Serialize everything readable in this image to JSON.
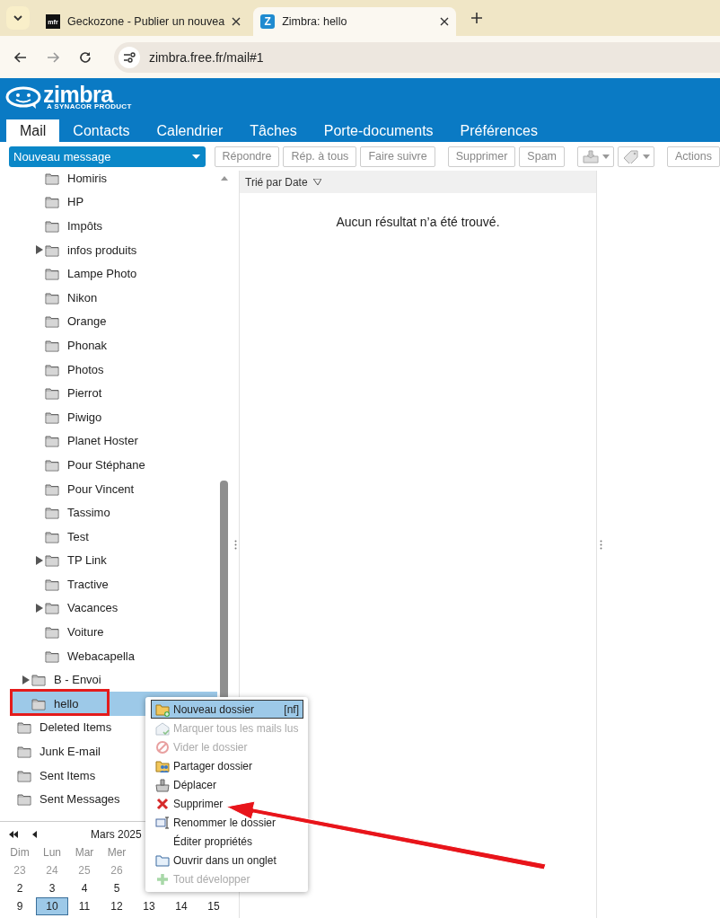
{
  "browser": {
    "tabs": [
      {
        "title": "Geckozone - Publier un nouvea",
        "icon": "mfr",
        "selected": false
      },
      {
        "title": "Zimbra: hello",
        "icon": "Z",
        "selected": true
      }
    ],
    "url": "zimbra.free.fr/mail#1"
  },
  "app": {
    "logo": "zimbra",
    "logo_tagline": "A SYNACOR PRODUCT",
    "tabs": [
      {
        "label": "Mail",
        "selected": true
      },
      {
        "label": "Contacts",
        "selected": false
      },
      {
        "label": "Calendrier",
        "selected": false
      },
      {
        "label": "Tâches",
        "selected": false
      },
      {
        "label": "Porte-documents",
        "selected": false
      },
      {
        "label": "Préférences",
        "selected": false
      }
    ]
  },
  "new_message_button": "Nouveau message",
  "toolbar": [
    {
      "kind": "text",
      "label": "Répondre"
    },
    {
      "kind": "text",
      "label": "Rép. à tous"
    },
    {
      "kind": "text",
      "label": "Faire suivre"
    },
    {
      "kind": "gap"
    },
    {
      "kind": "text",
      "label": "Supprimer"
    },
    {
      "kind": "text",
      "label": "Spam"
    },
    {
      "kind": "gap"
    },
    {
      "kind": "move"
    },
    {
      "kind": "tag"
    },
    {
      "kind": "gap"
    },
    {
      "kind": "text",
      "label": "Actions"
    }
  ],
  "folder_tree": [
    {
      "children": [
        {
          "children": [
            {
              "label": "Homiris",
              "expandable": false,
              "selected": false
            },
            {
              "label": "HP",
              "expandable": false,
              "selected": false
            },
            {
              "label": "Impôts",
              "expandable": false,
              "selected": false
            },
            {
              "label": "infos produits",
              "expandable": true,
              "selected": false
            },
            {
              "label": "Lampe Photo",
              "expandable": false,
              "selected": false
            },
            {
              "label": "Nikon",
              "expandable": false,
              "selected": false
            },
            {
              "label": "Orange",
              "expandable": false,
              "selected": false
            },
            {
              "label": "Phonak",
              "expandable": false,
              "selected": false
            },
            {
              "label": "Photos",
              "expandable": false,
              "selected": false
            },
            {
              "label": "Pierrot",
              "expandable": false,
              "selected": false
            },
            {
              "label": "Piwigo",
              "expandable": false,
              "selected": false
            },
            {
              "label": "Planet Hoster",
              "expandable": false,
              "selected": false
            },
            {
              "label": "Pour Stéphane",
              "expandable": false,
              "selected": false
            },
            {
              "label": "Pour Vincent",
              "expandable": false,
              "selected": false
            },
            {
              "label": "Tassimo",
              "expandable": false,
              "selected": false
            },
            {
              "label": "Test",
              "expandable": false,
              "selected": false
            },
            {
              "label": "TP Link",
              "expandable": true,
              "selected": false
            },
            {
              "label": "Tractive",
              "expandable": false,
              "selected": false
            },
            {
              "label": "Vacances",
              "expandable": true,
              "selected": false
            },
            {
              "label": "Voiture",
              "expandable": false,
              "selected": false
            },
            {
              "label": "Webacapella",
              "expandable": false,
              "selected": false
            }
          ]
        },
        {
          "label": "B - Envoi",
          "expandable": true,
          "selected": false
        },
        {
          "label": "hello",
          "expandable": false,
          "selected": true,
          "highlighted": true
        }
      ]
    },
    {
      "label": "Deleted Items",
      "expandable": false,
      "selected": false
    },
    {
      "label": "Junk E-mail",
      "expandable": false,
      "selected": false
    },
    {
      "label": "Sent Items",
      "expandable": false,
      "selected": false
    },
    {
      "label": "Sent Messages",
      "expandable": false,
      "selected": false
    }
  ],
  "calendar": {
    "month": "Mars 2025",
    "weekdays": [
      "Dim",
      "Lun",
      "Mar",
      "Mer"
    ],
    "weeks": [
      [
        {
          "day": "23",
          "other_month": true,
          "selected": false
        },
        {
          "day": "24",
          "other_month": true,
          "selected": false
        },
        {
          "day": "25",
          "other_month": true,
          "selected": false
        },
        {
          "day": "26",
          "other_month": true,
          "selected": false
        }
      ],
      [
        {
          "day": "2",
          "other_month": false,
          "selected": false
        },
        {
          "day": "3",
          "other_month": false,
          "selected": false
        },
        {
          "day": "4",
          "other_month": false,
          "selected": false
        },
        {
          "day": "5",
          "other_month": false,
          "selected": false
        }
      ],
      [
        {
          "day": "9",
          "other_month": false,
          "selected": false
        },
        {
          "day": "10",
          "other_month": false,
          "selected": true
        },
        {
          "day": "11",
          "other_month": false,
          "selected": false
        },
        {
          "day": "12",
          "other_month": false,
          "selected": false
        },
        {
          "day": "13",
          "other_month": false,
          "selected": false
        },
        {
          "day": "14",
          "other_month": false,
          "selected": false
        },
        {
          "day": "15",
          "other_month": false,
          "selected": false
        }
      ]
    ]
  },
  "message_list": {
    "sort_label": "Trié par Date",
    "empty_text": "Aucun résultat n’a été trouvé."
  },
  "context_menu": [
    {
      "kind": "new-folder",
      "label": "Nouveau dossier",
      "shortcut": "[nf]",
      "disabled": false,
      "selected": true
    },
    {
      "kind": "mark-read",
      "label": "Marquer tous les mails lus",
      "disabled": true,
      "selected": false
    },
    {
      "kind": "empty",
      "label": "Vider le dossier",
      "disabled": true,
      "selected": false
    },
    {
      "kind": "share",
      "label": "Partager dossier",
      "disabled": false,
      "selected": false
    },
    {
      "kind": "move",
      "label": "Déplacer",
      "disabled": false,
      "selected": false
    },
    {
      "kind": "delete",
      "label": "Supprimer",
      "disabled": false,
      "selected": false
    },
    {
      "kind": "rename",
      "label": "Renommer le dossier",
      "disabled": false,
      "selected": false
    },
    {
      "kind": "properties",
      "label": "Éditer propriétés",
      "disabled": false,
      "selected": false
    },
    {
      "kind": "open-tab",
      "label": "Ouvrir dans un onglet",
      "disabled": false,
      "selected": false
    },
    {
      "kind": "expand-all",
      "label": "Tout développer",
      "disabled": true,
      "selected": false
    }
  ]
}
